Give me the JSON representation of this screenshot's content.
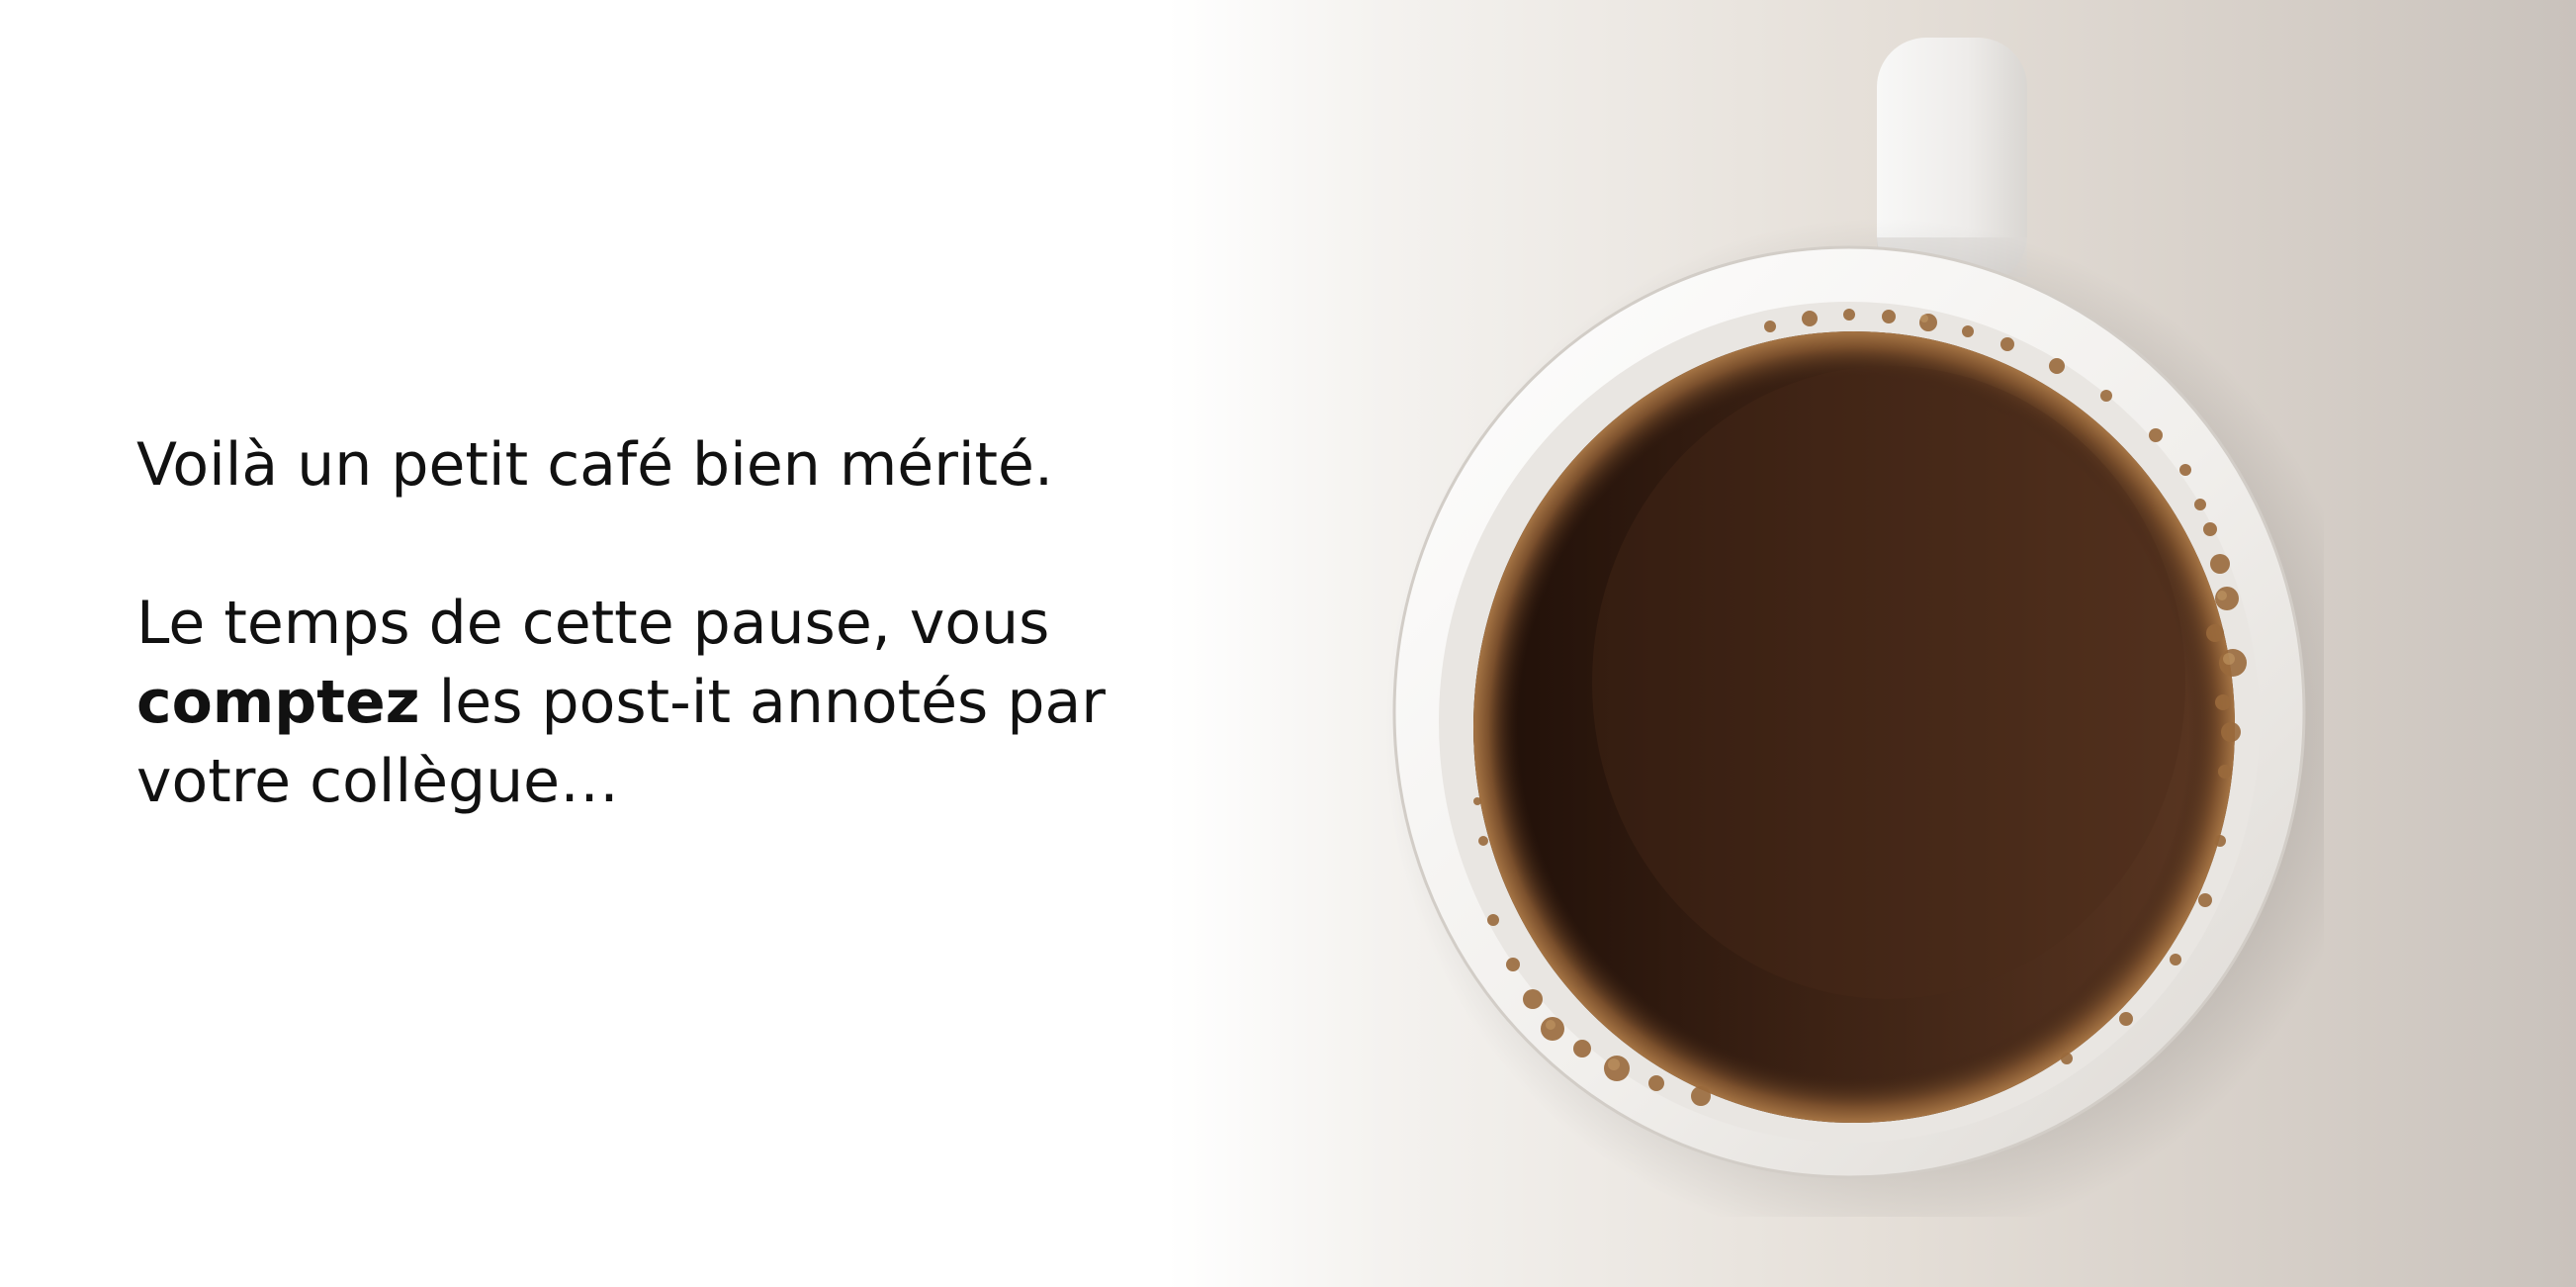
{
  "slide": {
    "line1": "Voilà un petit café bien mérité.",
    "line2_start": "Le temps de cette pause, vous ",
    "line2_bold": "comptez",
    "line2_end": " les post-it annotés par votre collègue…"
  },
  "image": {
    "icon": "coffee-cup-top-view-icon",
    "colors": {
      "coffee_dark": "#2a150c",
      "coffee_light": "#5a3723",
      "crema": "#8a5a34",
      "cup": "#f7f6f4",
      "background_shadow": "#c9c2bc"
    }
  }
}
